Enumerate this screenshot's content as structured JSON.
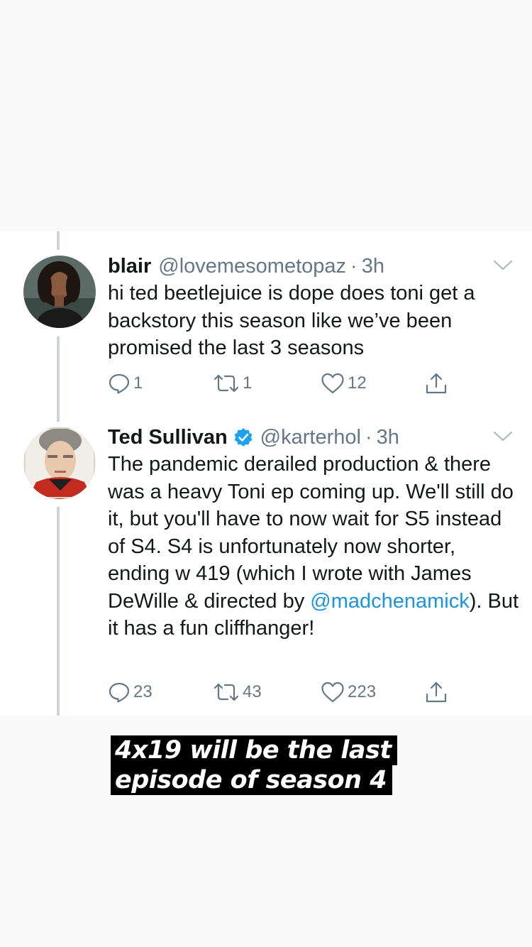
{
  "tweets": [
    {
      "name": "blair",
      "handle": "@lovemesometopaz",
      "dot": "·",
      "time": "3h",
      "verified": false,
      "text": "hi ted beetlejuice is dope does toni get a backstory this season like we’ve been promised the last 3 seasons",
      "replies": "1",
      "retweets": "1",
      "likes": "12"
    },
    {
      "name": "Ted Sullivan",
      "handle": "@karterhol",
      "dot": "·",
      "time": "3h",
      "verified": true,
      "text_before_mention": "The pandemic derailed production & there was a heavy Toni ep coming up. We'll still do it, but you'll have to now wait for S5 instead of S4. S4 is unfortunately now shorter, ending w 419 (which I wrote with James DeWille & directed by ",
      "mention": "@madchenamick",
      "text_after_mention": "). But it has a fun cliffhanger!",
      "replies": "23",
      "retweets": "43",
      "likes": "223"
    }
  ],
  "caption": {
    "line1": "4x19 will be the last",
    "line2": "episode of season 4"
  },
  "colors": {
    "text": "#14171a",
    "secondary": "#657786",
    "link": "#1b95e0",
    "verified": "#1da1f2",
    "thread_line": "#cdd3d8",
    "background": "#f9f9f9"
  },
  "icons": [
    "reply-icon",
    "retweet-icon",
    "like-icon",
    "share-icon",
    "chevron-down-icon",
    "verified-badge-icon"
  ]
}
